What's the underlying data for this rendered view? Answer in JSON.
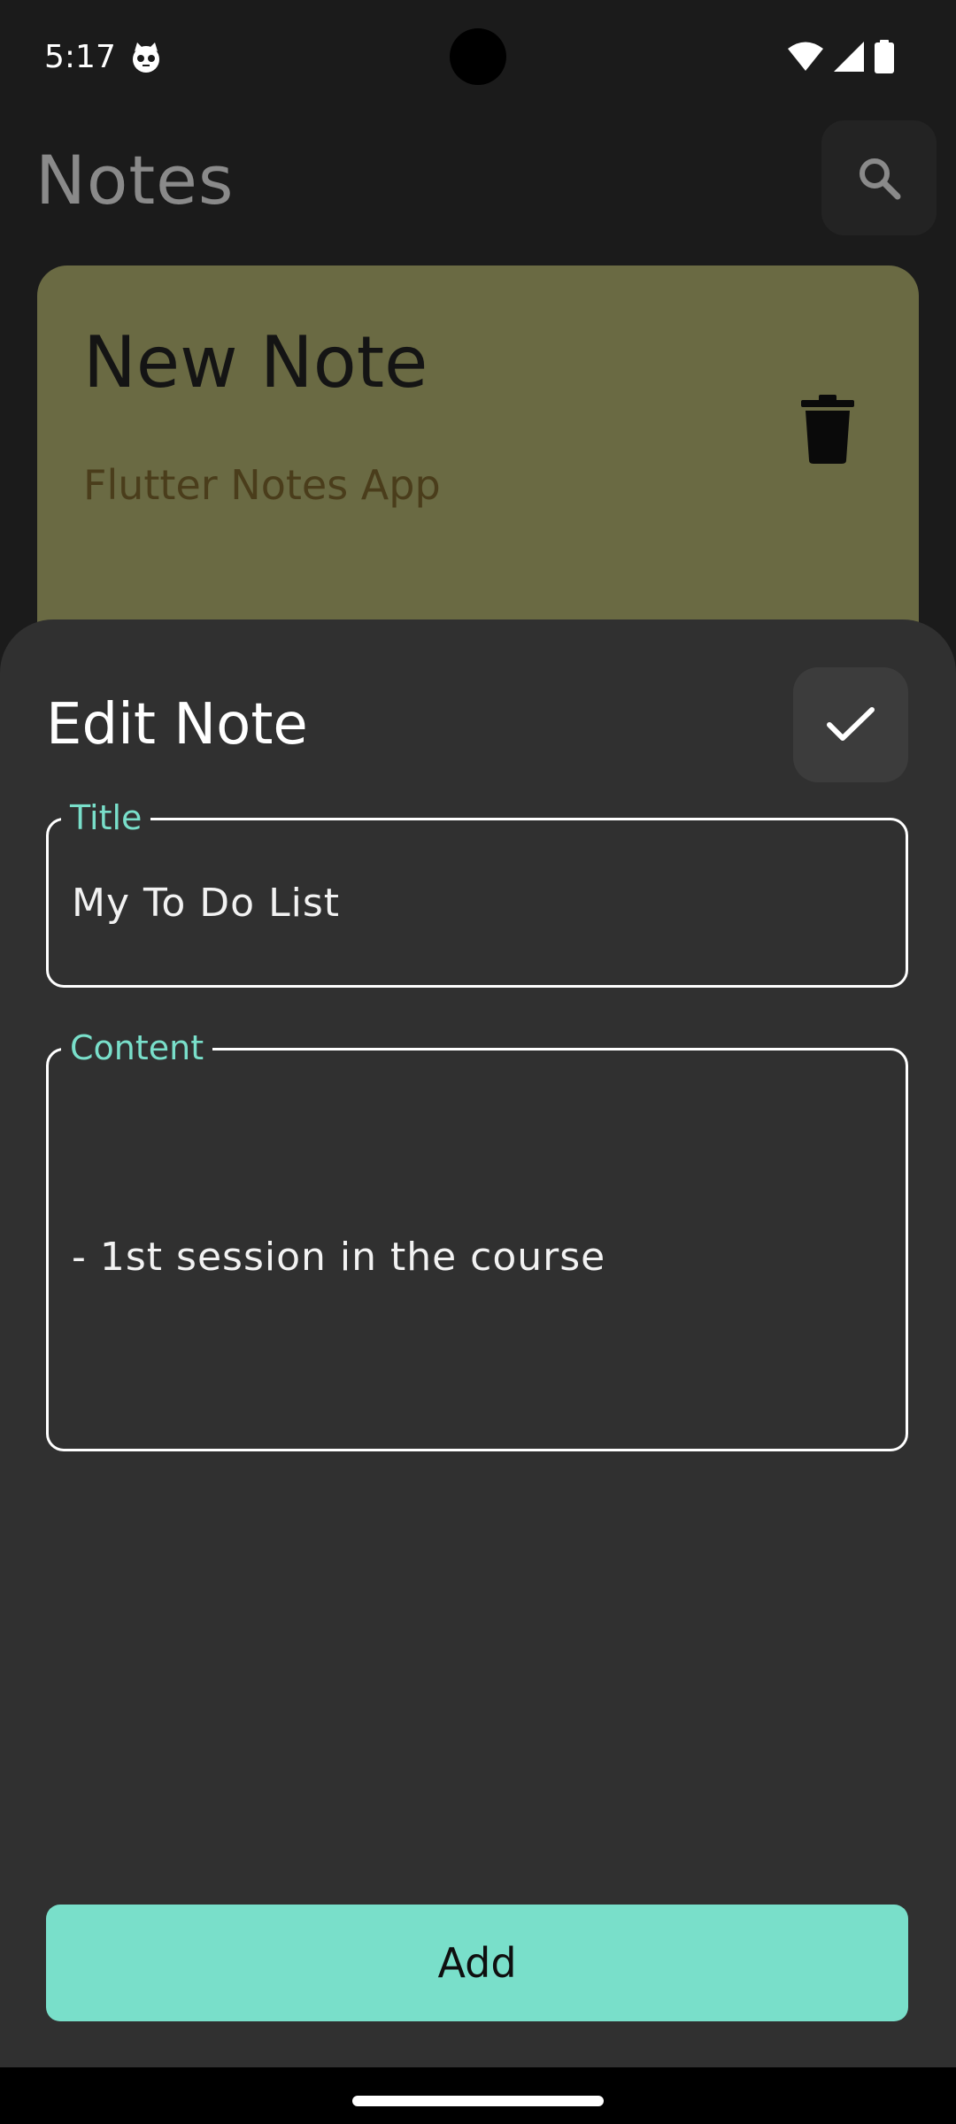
{
  "status_bar": {
    "time": "5:17",
    "left_icons": [
      "cat-face-icon"
    ],
    "right_icons": [
      "wifi-icon",
      "cellular-signal-icon",
      "battery-icon"
    ]
  },
  "app": {
    "title": "Notes",
    "search_icon": "search-icon"
  },
  "note_card": {
    "title": "New Note",
    "subtitle": "Flutter Notes App",
    "color": "#6a6a43",
    "delete_icon": "trash-icon"
  },
  "sheet": {
    "title": "Edit Note",
    "save_icon": "check-icon",
    "title_field": {
      "label": "Title",
      "value": "My To Do List"
    },
    "content_field": {
      "label": "Content",
      "value": "- 1st session in the course"
    },
    "add_button_label": "Add",
    "accent_color": "#79dfca"
  }
}
